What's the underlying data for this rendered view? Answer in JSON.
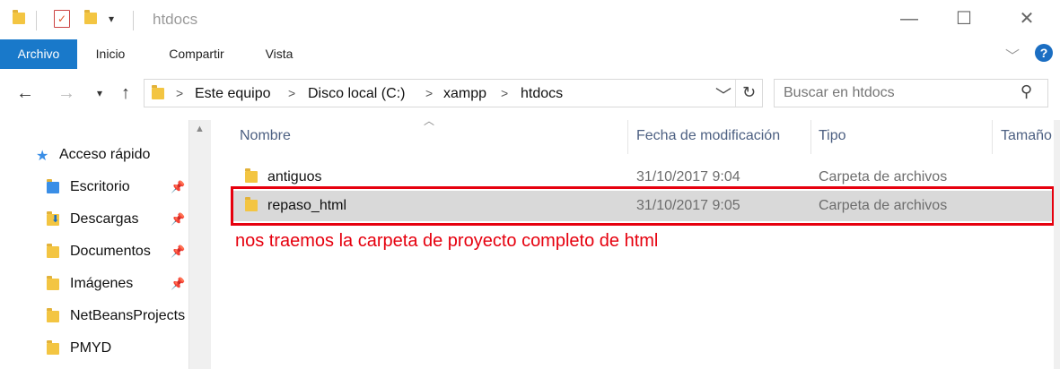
{
  "window": {
    "title": "htdocs",
    "minimize_glyph": "—",
    "maximize_glyph": "☐",
    "close_glyph": "✕"
  },
  "ribbon": {
    "tabs": [
      "Archivo",
      "Inicio",
      "Compartir",
      "Vista"
    ],
    "help_glyph": "?"
  },
  "address": {
    "crumbs": [
      "Este equipo",
      "Disco local (C:)",
      "xampp",
      "htdocs"
    ]
  },
  "search": {
    "placeholder": "Buscar en htdocs"
  },
  "nav_pane": {
    "quick_access": "Acceso rápido",
    "items": [
      {
        "label": "Escritorio",
        "pinned": true
      },
      {
        "label": "Descargas",
        "pinned": true
      },
      {
        "label": "Documentos",
        "pinned": true
      },
      {
        "label": "Imágenes",
        "pinned": true
      },
      {
        "label": "NetBeansProjects",
        "pinned": false
      },
      {
        "label": "PMYD",
        "pinned": false
      }
    ]
  },
  "columns": {
    "name": "Nombre",
    "date": "Fecha de modificación",
    "type": "Tipo",
    "size": "Tamaño"
  },
  "files": [
    {
      "name": "antiguos",
      "date": "31/10/2017 9:04",
      "type": "Carpeta de archivos",
      "selected": false
    },
    {
      "name": "repaso_html",
      "date": "31/10/2017 9:05",
      "type": "Carpeta de archivos",
      "selected": true
    }
  ],
  "annotation": {
    "text": "nos traemos la carpeta de proyecto completo de html",
    "color": "#e6000e"
  },
  "colors": {
    "accent": "#1979ca",
    "folder": "#f3c542",
    "selection": "#d9d9d9",
    "column_header": "#4d6082"
  }
}
